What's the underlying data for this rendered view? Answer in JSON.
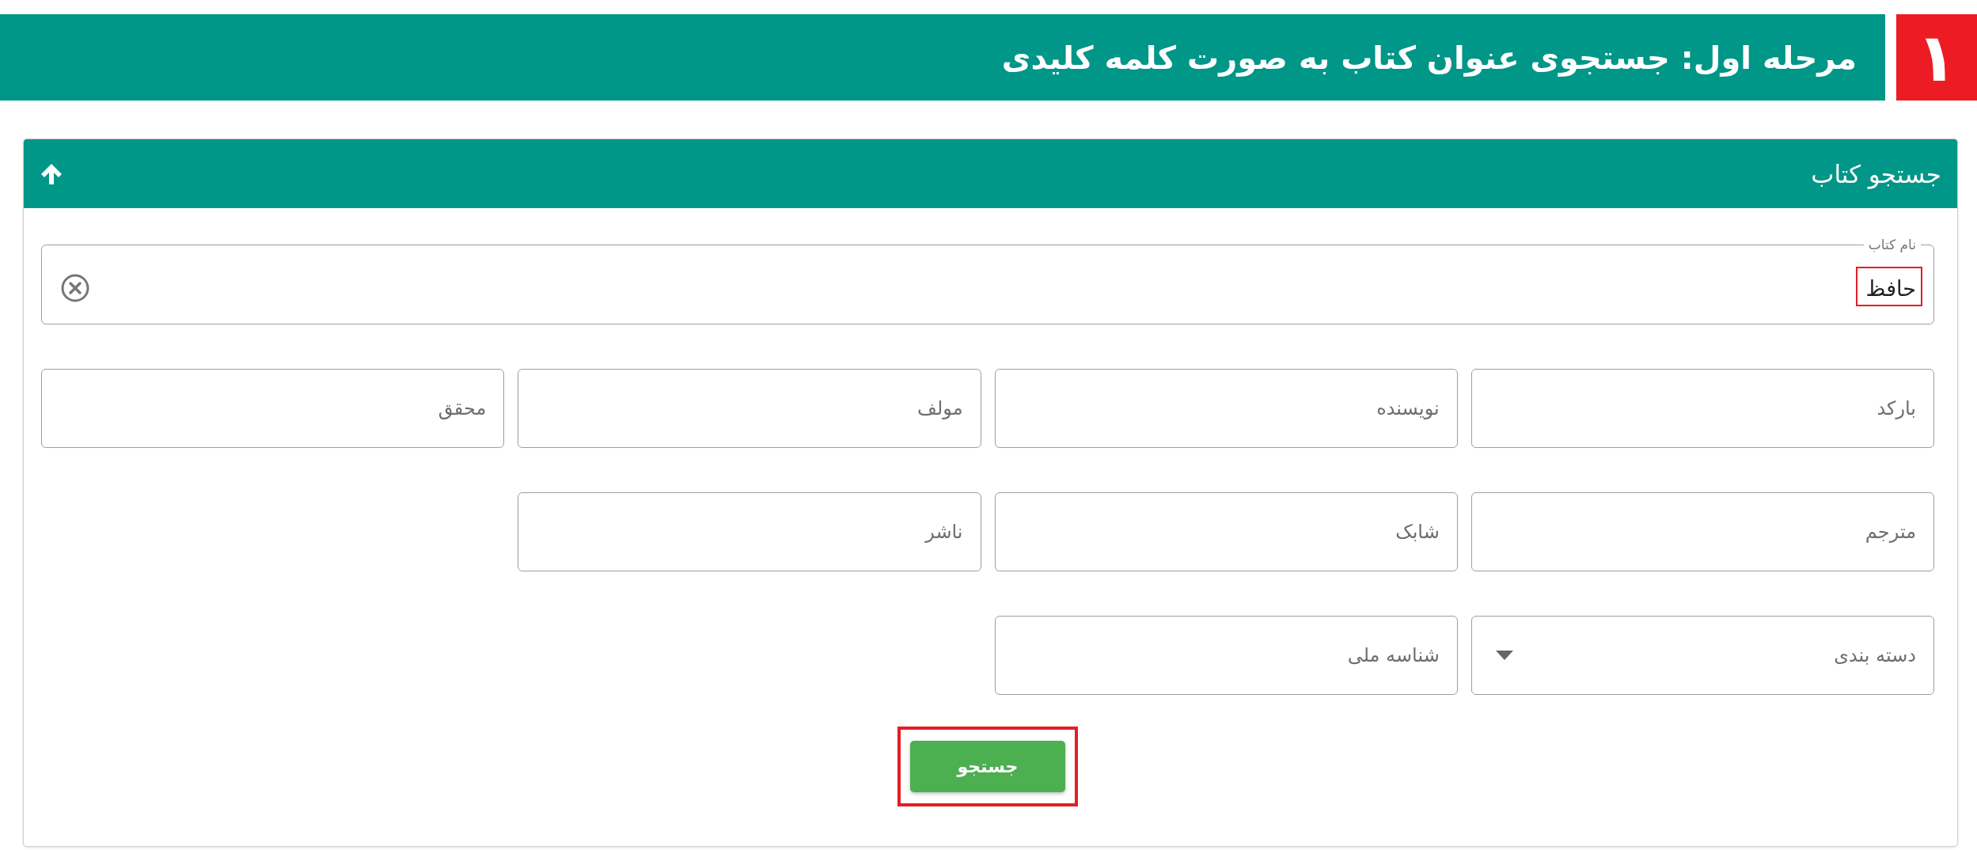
{
  "header": {
    "step_number": "۱",
    "title": "مرحله اول: جستجوی عنوان کتاب به صورت کلمه کلیدی"
  },
  "panel": {
    "title": "جستجو کتاب",
    "expanded": true
  },
  "name_field": {
    "label": "نام کتاب",
    "value": "حافظ",
    "highlighted": true
  },
  "rows": [
    {
      "fields": [
        {
          "kind": "text",
          "placeholder": "بارکد"
        },
        {
          "kind": "text",
          "placeholder": "نویسنده"
        },
        {
          "kind": "text",
          "placeholder": "مولف"
        },
        {
          "kind": "text",
          "placeholder": "محقق"
        }
      ]
    },
    {
      "fields": [
        {
          "kind": "text",
          "placeholder": "مترجم"
        },
        {
          "kind": "text",
          "placeholder": "شابک"
        },
        {
          "kind": "text",
          "placeholder": "ناشر"
        }
      ]
    },
    {
      "fields": [
        {
          "kind": "select",
          "placeholder": "دسته بندی"
        },
        {
          "kind": "text",
          "placeholder": "شناسه ملی"
        }
      ]
    }
  ],
  "search_button": {
    "label": "جستجو",
    "highlighted": true
  }
}
